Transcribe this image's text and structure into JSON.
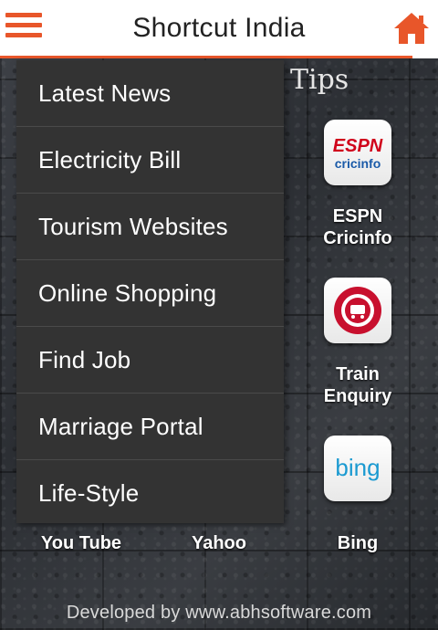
{
  "header": {
    "title": "Shortcut India"
  },
  "background": {
    "section_title": "Tips",
    "tiles": [
      {
        "label_line1": "ESPN",
        "label_line2": "Cricinfo",
        "icon": "espn-cricinfo-logo"
      },
      {
        "label_line1": "Train",
        "label_line2": "Enquiry",
        "icon": "indian-railways-logo"
      },
      {
        "label_line1": "",
        "label_line2": "",
        "icon": "bing-logo"
      }
    ],
    "bottom_labels": [
      "You Tube",
      "Yahoo",
      "Bing"
    ]
  },
  "drawer": {
    "items": [
      "Latest News",
      "Electricity Bill",
      "Tourism Websites",
      "Online Shopping",
      "Find Job",
      "Marriage Portal",
      "Life-Style"
    ]
  },
  "footer": {
    "text": "Developed by www.abhsoftware.com"
  },
  "colors": {
    "accent": "#e8562a",
    "drawer_bg": "#333333"
  },
  "logos": {
    "espn_top": "ESPN",
    "espn_bottom": "cricinfo",
    "bing": "bing"
  }
}
